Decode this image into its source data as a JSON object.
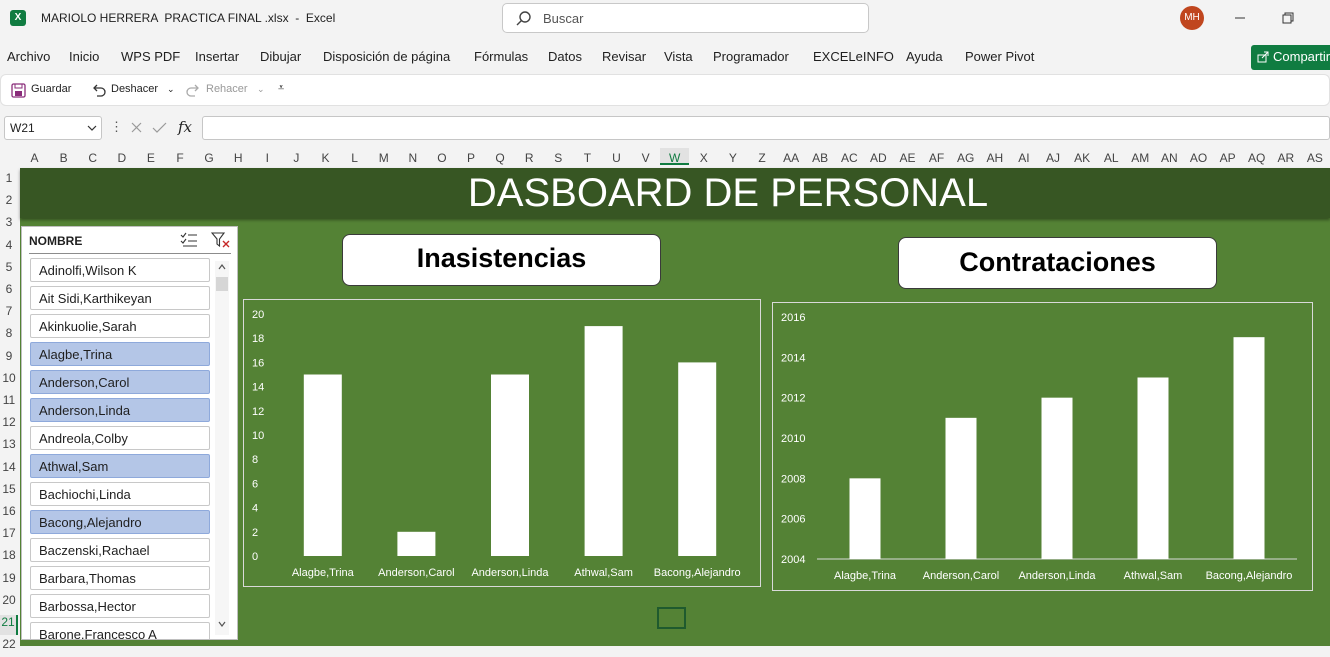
{
  "window": {
    "app_badge": "X",
    "title": "MARIOLO HERRERA  PRACTICA FINAL .xlsx  -  Excel",
    "search_placeholder": "Buscar",
    "user_initials": "MH"
  },
  "menu": [
    "Archivo",
    "Inicio",
    "WPS PDF",
    "Insertar",
    "Dibujar",
    "Disposición de página",
    "Fórmulas",
    "Datos",
    "Revisar",
    "Vista",
    "Programador",
    "EXCELeINFO",
    "Ayuda",
    "Power Pivot"
  ],
  "share_label": "Compartir",
  "quick_access": {
    "save": "Guardar",
    "undo": "Deshacer",
    "redo": "Rehacer"
  },
  "formula_bar": {
    "cell_ref": "W21",
    "formula": ""
  },
  "columns": [
    "A",
    "B",
    "C",
    "D",
    "E",
    "F",
    "G",
    "H",
    "I",
    "J",
    "K",
    "L",
    "M",
    "N",
    "O",
    "P",
    "Q",
    "R",
    "S",
    "T",
    "U",
    "V",
    "W",
    "X",
    "Y",
    "Z",
    "AA",
    "AB",
    "AC",
    "AD",
    "AE",
    "AF",
    "AG",
    "AH",
    "AI",
    "AJ",
    "AK",
    "AL",
    "AM",
    "AN",
    "AO",
    "AP",
    "AQ",
    "AR",
    "AS"
  ],
  "selected_column": "W",
  "rows": [
    "1",
    "2",
    "3",
    "4",
    "5",
    "6",
    "7",
    "8",
    "9",
    "10",
    "11",
    "12",
    "13",
    "14",
    "15",
    "16",
    "17",
    "18",
    "19",
    "20",
    "21",
    "22"
  ],
  "selected_row": "21",
  "dashboard_title": "DASBOARD DE PERSONAL",
  "slicer": {
    "title": "NOMBRE",
    "items": [
      {
        "name": "Adinolfi,Wilson K",
        "selected": false
      },
      {
        "name": "Ait Sidi,Karthikeyan",
        "selected": false
      },
      {
        "name": "Akinkuolie,Sarah",
        "selected": false
      },
      {
        "name": "Alagbe,Trina",
        "selected": true
      },
      {
        "name": "Anderson,Carol",
        "selected": true
      },
      {
        "name": "Anderson,Linda",
        "selected": true
      },
      {
        "name": "Andreola,Colby",
        "selected": false
      },
      {
        "name": "Athwal,Sam",
        "selected": true
      },
      {
        "name": "Bachiochi,Linda",
        "selected": false
      },
      {
        "name": "Bacong,Alejandro",
        "selected": true
      },
      {
        "name": "Baczenski,Rachael",
        "selected": false
      },
      {
        "name": "Barbara,Thomas",
        "selected": false
      },
      {
        "name": "Barbossa,Hector",
        "selected": false
      },
      {
        "name": "Barone,Francesco A",
        "selected": false
      }
    ]
  },
  "colors": {
    "sheet_bg": "#548235",
    "banner_bg": "#375623",
    "bar": "#ffffff",
    "selected_item": "#b4c6e7"
  },
  "chart_data": [
    {
      "type": "bar",
      "title": "Inasistencias",
      "categories": [
        "Alagbe,Trina",
        "Anderson,Carol",
        "Anderson,Linda",
        "Athwal,Sam",
        "Bacong,Alejandro"
      ],
      "values": [
        15,
        2,
        15,
        19,
        16
      ],
      "ylim": [
        0,
        20
      ],
      "yticks": [
        0,
        2,
        4,
        6,
        8,
        10,
        12,
        14,
        16,
        18,
        20
      ],
      "grid": false
    },
    {
      "type": "bar",
      "title": "Contrataciones",
      "categories": [
        "Alagbe,Trina",
        "Anderson,Carol",
        "Anderson,Linda",
        "Athwal,Sam",
        "Bacong,Alejandro"
      ],
      "values": [
        2008,
        2011,
        2012,
        2013,
        2015
      ],
      "ylim": [
        2004,
        2016
      ],
      "yticks": [
        2004,
        2006,
        2008,
        2010,
        2012,
        2014,
        2016
      ],
      "grid": false
    }
  ]
}
